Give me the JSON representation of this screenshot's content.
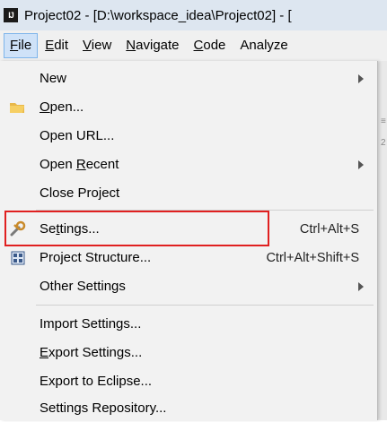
{
  "window": {
    "title": "Project02 - [D:\\workspace_idea\\Project02] - ["
  },
  "app_icon": {
    "text": "IJ",
    "name": "intellij-icon"
  },
  "menubar": {
    "items": [
      {
        "label": "File",
        "u": "F",
        "rest": "ile",
        "active": true
      },
      {
        "label": "Edit",
        "u": "E",
        "rest": "dit"
      },
      {
        "label": "View",
        "u": "V",
        "rest": "iew"
      },
      {
        "label": "Navigate",
        "u": "N",
        "rest": "avigate"
      },
      {
        "label": "Code",
        "u": "C",
        "rest": "ode"
      },
      {
        "label": "Analyze",
        "u": "",
        "rest": "Analyze"
      }
    ]
  },
  "file_menu": {
    "items": [
      {
        "label": "New",
        "has_submenu": true
      },
      {
        "label": "Open...",
        "u_char": "O",
        "rest": "pen...",
        "icon": "folder-icon"
      },
      {
        "label": "Open URL..."
      },
      {
        "label": "Open Recent",
        "pre": "Open ",
        "u_char": "R",
        "rest": "ecent",
        "has_submenu": true
      },
      {
        "label": "Close Project"
      },
      {
        "label": "Settings...",
        "pre": "Se",
        "u_char": "t",
        "rest": "tings...",
        "shortcut": "Ctrl+Alt+S",
        "icon": "wrench-icon",
        "highlighted": true
      },
      {
        "label": "Project Structure...",
        "shortcut": "Ctrl+Alt+Shift+S",
        "icon": "project-structure-icon"
      },
      {
        "label": "Other Settings",
        "has_submenu": true
      },
      {
        "label": "Import Settings..."
      },
      {
        "label": "Export Settings...",
        "u_char": "E",
        "rest": "xport Settings..."
      },
      {
        "label": "Export to Eclipse..."
      },
      {
        "label": "Settings Repository..."
      }
    ]
  },
  "colors": {
    "highlight_border": "#e02020",
    "menu_active_bg": "#cfe2f8",
    "folder": "#e8b84a"
  }
}
